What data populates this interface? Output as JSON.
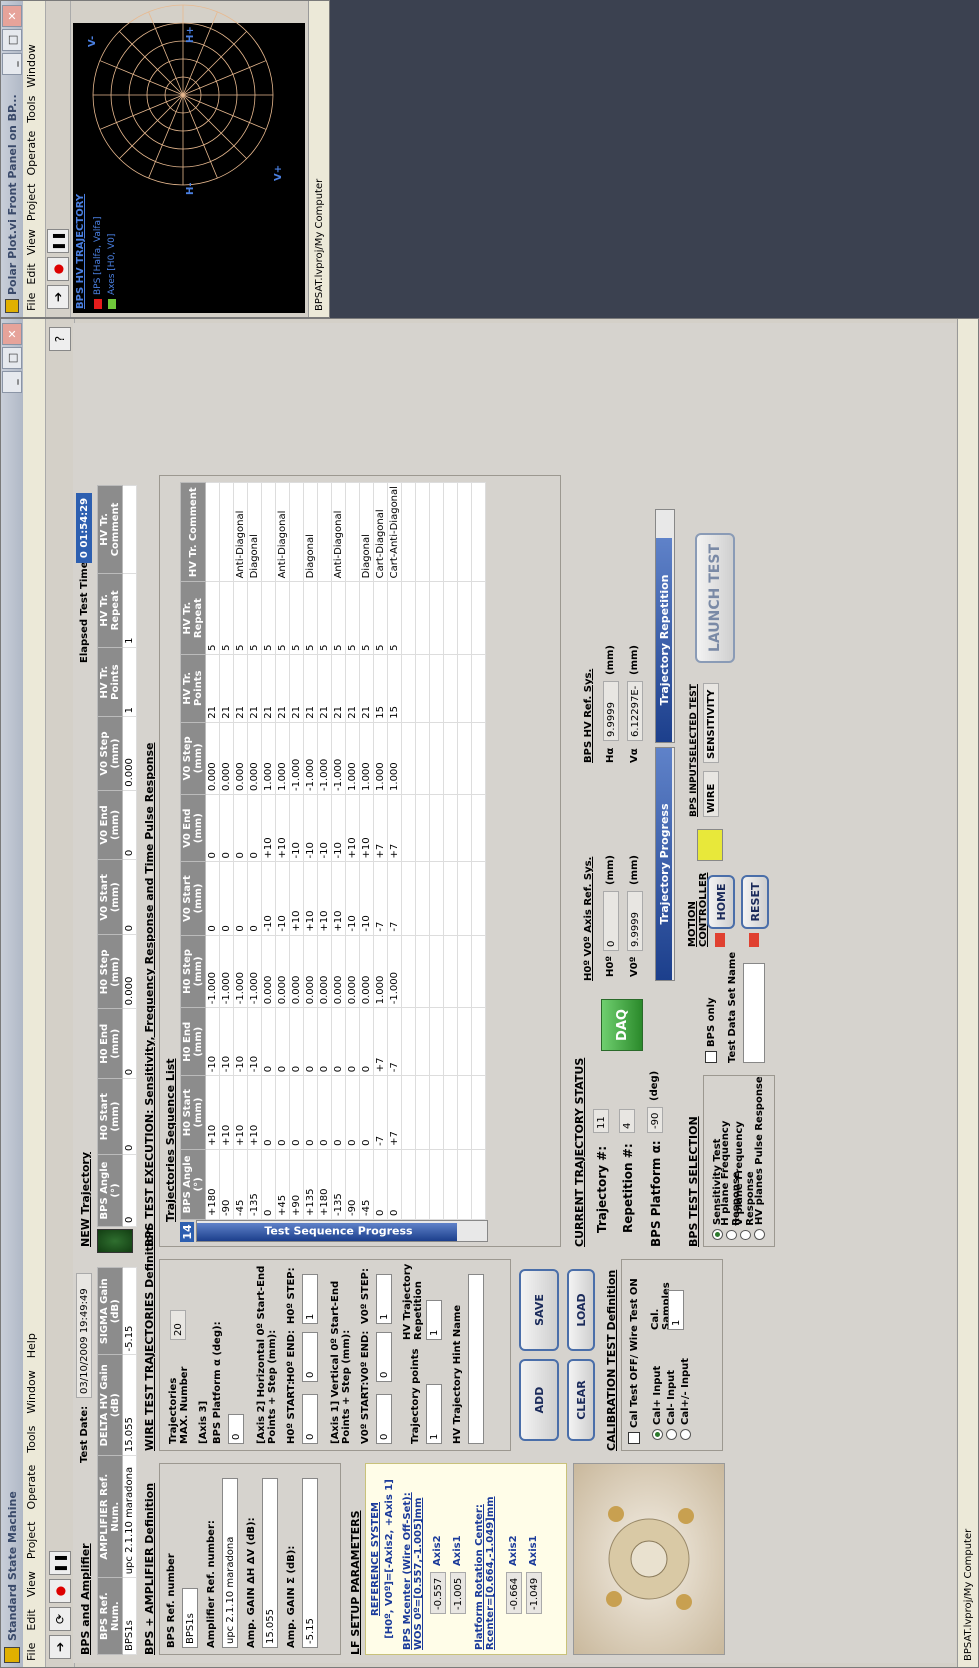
{
  "main_window": {
    "title": "Standard State Machine",
    "menu": [
      "File",
      "Edit",
      "View",
      "Project",
      "Operate",
      "Tools",
      "Window",
      "Help"
    ],
    "status": "BPSAT.lvproj/My Computer"
  },
  "bps_amplifier": {
    "header": "BPS and Amplifier",
    "test_date_label": "Test Date:",
    "test_date": "03/10/2009 19:49:49",
    "columns": [
      "BPS Ref. Num.",
      "AMPLIFIER Ref. Num.",
      "DELTA HV Gain (dB)",
      "SIGMA Gain (dB)"
    ],
    "row": [
      "BPS1s",
      "upc 2.1.10 maradona",
      "15.055",
      "-5.15"
    ]
  },
  "new_trajectory": {
    "header": "NEW Trajectory",
    "elapsed_label": "Elapsed Test Time:",
    "elapsed": "0 01:54:29",
    "columns": [
      "BPS Angle (°)",
      "H0 Start (mm)",
      "H0 End (mm)",
      "H0 Step (mm)",
      "V0 Start (mm)",
      "V0 End (mm)",
      "V0 Step (mm)",
      "HV Tr. Points",
      "HV Tr. Repeat",
      "HV Tr. Comment"
    ],
    "row": [
      "0",
      "0",
      "0",
      "0.000",
      "0",
      "0",
      "0.000",
      "1",
      "1",
      ""
    ]
  },
  "bps_amp_def": {
    "header": "BPS + AMPLIFIER Definition",
    "bps_ref_label": "BPS Ref. number",
    "bps_ref": "BPS1s",
    "amp_ref_label": "Amplifier Ref. number:",
    "amp_ref": "upc 2.1.10 maradona",
    "gain_dhv_label": "Amp. GAIN ΔH ΔV (dB):",
    "gain_dhv": "15.055",
    "gain_sigma_label": "Amp. GAIN Σ (dB):",
    "gain_sigma": "-5.15"
  },
  "wire_def": {
    "header": "WIRE TEST TRAJECTORIES Definition",
    "max_label": "Trajectories MAX. Number",
    "max": "20",
    "axis3": "[Axis 3]",
    "platform_label": "BPS Platform α (deg):",
    "platform": "0",
    "axis2": "[Axis 2] Horizontal 0º Start-End Points + Step (mm):",
    "h_labels": [
      "H0º START:",
      "H0º END:",
      "H0º STEP:"
    ],
    "h_values": [
      "0",
      "0",
      "1"
    ],
    "axis1": "[Axis 1] Vertical 0º Start-End Points + Step (mm):",
    "v_labels": [
      "V0º START:",
      "V0º END:",
      "V0º STEP:"
    ],
    "v_values": [
      "0",
      "0",
      "1"
    ],
    "points_label": "Trajectory points",
    "points": "1",
    "rep_label": "HV Trajectory Repetition",
    "rep": "1",
    "hint_label": "HV Trajectory Hint Name",
    "buttons": {
      "add": "ADD",
      "save": "SAVE",
      "clear": "CLEAR",
      "load": "LOAD"
    }
  },
  "execution": {
    "header": "BPS TEST EXECUTION: Sensitivity, Frequency Response and Time Pulse Response",
    "seq_header": "Trajectories Sequence List",
    "seq_count": "14",
    "progress_label": "Test Sequence Progress",
    "columns": [
      "BPS Angle (°)",
      "H0 Start (mm)",
      "H0 End (mm)",
      "H0 Step (mm)",
      "V0 Start (mm)",
      "V0 End (mm)",
      "V0 Step (mm)",
      "HV Tr. Points",
      "HV Tr. Repeat",
      "HV Tr. Comment"
    ],
    "rows": [
      [
        "+180",
        "+10",
        "-10",
        "-1.000",
        "0",
        "0",
        "0.000",
        "21",
        "5",
        ""
      ],
      [
        "-90",
        "+10",
        "-10",
        "-1.000",
        "0",
        "0",
        "0.000",
        "21",
        "5",
        ""
      ],
      [
        "-45",
        "+10",
        "-10",
        "-1.000",
        "0",
        "0",
        "0.000",
        "21",
        "5",
        "Anti-Diagonal"
      ],
      [
        "-135",
        "+10",
        "-10",
        "-1.000",
        "0",
        "0",
        "0.000",
        "21",
        "5",
        "Diagonal"
      ],
      [
        "0",
        "0",
        "0",
        "0.000",
        "-10",
        "+10",
        "1.000",
        "21",
        "5",
        ""
      ],
      [
        "+45",
        "0",
        "0",
        "0.000",
        "-10",
        "+10",
        "1.000",
        "21",
        "5",
        "Anti-Diagonal"
      ],
      [
        "+90",
        "0",
        "0",
        "0.000",
        "+10",
        "-10",
        "-1.000",
        "21",
        "5",
        ""
      ],
      [
        "+135",
        "0",
        "0",
        "0.000",
        "+10",
        "-10",
        "-1.000",
        "21",
        "5",
        "Diagonal"
      ],
      [
        "+180",
        "0",
        "0",
        "0.000",
        "+10",
        "-10",
        "-1.000",
        "21",
        "5",
        ""
      ],
      [
        "-135",
        "0",
        "0",
        "0.000",
        "+10",
        "-10",
        "-1.000",
        "21",
        "5",
        "Anti-Diagonal"
      ],
      [
        "-90",
        "0",
        "0",
        "0.000",
        "-10",
        "+10",
        "1.000",
        "21",
        "5",
        ""
      ],
      [
        "-45",
        "0",
        "0",
        "0.000",
        "-10",
        "+10",
        "1.000",
        "21",
        "5",
        "Diagonal"
      ],
      [
        "0",
        "-7",
        "+7",
        "1.000",
        "-7",
        "+7",
        "1.000",
        "15",
        "5",
        "Cart-Diagonal"
      ],
      [
        "0",
        "+7",
        "-7",
        "-1.000",
        "-7",
        "+7",
        "1.000",
        "15",
        "5",
        "Cart-Anti-Diagonal"
      ]
    ]
  },
  "current_status": {
    "header": "CURRENT TRAJECTORY STATUS",
    "traj_label": "Trajectory #:",
    "traj": "11",
    "rep_label": "Repetition #:",
    "rep": "4",
    "alpha_label": "BPS Platform α:",
    "alpha": "-90",
    "alpha_unit": "(deg)",
    "daq": "DAQ",
    "axis_ref_header": "H0º V0º Axis Ref. Sys.",
    "h0_label": "H0º",
    "h0": "0",
    "v0_label": "V0º",
    "v0": "9.9999",
    "unit": "(mm)",
    "hv_ref_header": "BPS HV Ref. Sys.",
    "ha_label": "Hα",
    "ha": "9.9999",
    "va_label": "Vα",
    "va": "6.12297E-",
    "traj_progress": "Trajectory Progress",
    "traj_repetition": "Trajectory Repetition"
  },
  "lf_setup": {
    "header": "LF SETUP PARAMETERS",
    "ref_sys": "REFERENCE SYSTEM",
    "ref_formula": "[H0º, V0º]=[-Axis2, +Axis 1]",
    "mcenter_title": "BPS Mcenter (Wire Off-Set): WOS 0º=[0.557,-1.005]mm",
    "mcenter_axis2": "-0.557",
    "mcenter_axis1": "-1.005",
    "rcenter_title": "Platform Rotation Center: Rcenter=[0.664,-1.049]mm",
    "rcenter_axis2": "-0.664",
    "rcenter_axis1": "-1.049",
    "axis2_label": "Axis2",
    "axis1_label": "Axis1"
  },
  "calibration": {
    "header": "CALIBRATION TEST Definition",
    "check_label": "Cal Test OFF/ Wire Test ON",
    "options": [
      "Cal+ Input",
      "Cal- Input",
      "Cal+/- Input"
    ],
    "samples_label": "Cal. Samples",
    "samples": "1"
  },
  "test_selection": {
    "header": "BPS TEST SELECTION",
    "options": [
      "Sensitivity Test",
      "H plane Frequency Response",
      "V plane Frequency Response",
      "HV planes Pulse Response"
    ],
    "bps_only": "BPS only",
    "dataset_label": "Test Data Set Name",
    "motion_header": "MOTION CONTROLLER",
    "home": "HOME",
    "reset": "RESET",
    "bps_input_label": "BPS INPUT",
    "bps_input": "WIRE",
    "selected_test_label": "SELECTED TEST",
    "selected_test": "SENSITIVITY",
    "launch": "LAUNCH TEST"
  },
  "polar_window": {
    "title": "Polar Plot.vi Front Panel on BP...",
    "menu": [
      "File",
      "Edit",
      "View",
      "Project",
      "Operate",
      "Tools",
      "Window"
    ],
    "plot_title": "BPS HV TRAJECTORY",
    "legend": [
      "BPS [Halfa, Valfa]",
      "Axes [H0, V0]"
    ],
    "axis_labels": {
      "h_minus": "H-",
      "h_plus": "H+",
      "v_plus": "V+",
      "v_minus": "V-"
    },
    "status": "BPSAT.lvproj/My Computer",
    "colors": {
      "grid": "#e8b98f",
      "legend_red": "#e51c1c",
      "legend_green": "#6fc83a"
    }
  }
}
